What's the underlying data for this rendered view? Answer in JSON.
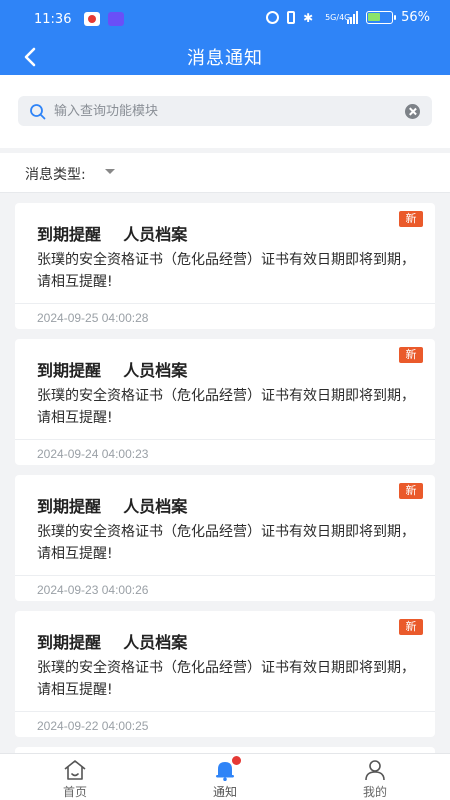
{
  "status_bar": {
    "time": "11:36",
    "network": "5G/4G",
    "battery_percent": "56%",
    "battery_level": 0.56,
    "battery_color": "#8be36b"
  },
  "header": {
    "title": "消息通知",
    "back_icon": "chevron-left-icon",
    "background_color": "#2f84f7"
  },
  "search": {
    "value": "",
    "placeholder": "输入查询功能模块",
    "search_icon": "search-icon",
    "clear_icon": "clear-icon"
  },
  "filter": {
    "label": "消息类型:",
    "selected_value": "",
    "dropdown_icon": "chevron-down-icon"
  },
  "notices": [
    {
      "title": "到期提醒    人员档案",
      "badge": "新",
      "body": "张璞的安全资格证书（危化品经营）证书有效日期即将到期，请相互提醒!",
      "time": "2024-09-25 04:00:28"
    },
    {
      "title": "到期提醒    人员档案",
      "badge": "新",
      "body": "张璞的安全资格证书（危化品经营）证书有效日期即将到期，请相互提醒!",
      "time": "2024-09-24 04:00:23"
    },
    {
      "title": "到期提醒    人员档案",
      "badge": "新",
      "body": "张璞的安全资格证书（危化品经营）证书有效日期即将到期，请相互提醒!",
      "time": "2024-09-23 04:00:26"
    },
    {
      "title": "到期提醒    人员档案",
      "badge": "新",
      "body": "张璞的安全资格证书（危化品经营）证书有效日期即将到期，请相互提醒!",
      "time": "2024-09-22 04:00:25"
    }
  ],
  "tab_bar": {
    "tabs": [
      {
        "label": "首页",
        "icon": "home-icon"
      },
      {
        "label": "通知",
        "icon": "bell-icon",
        "active": true,
        "has_dot": true
      },
      {
        "label": "我的",
        "icon": "user-icon"
      }
    ],
    "active_color": "#2f84f7",
    "dot_color": "#e53935"
  },
  "colors": {
    "accent": "#2f84f7",
    "badge": "#ea5a2b",
    "page_bg": "#f2f3f5"
  }
}
